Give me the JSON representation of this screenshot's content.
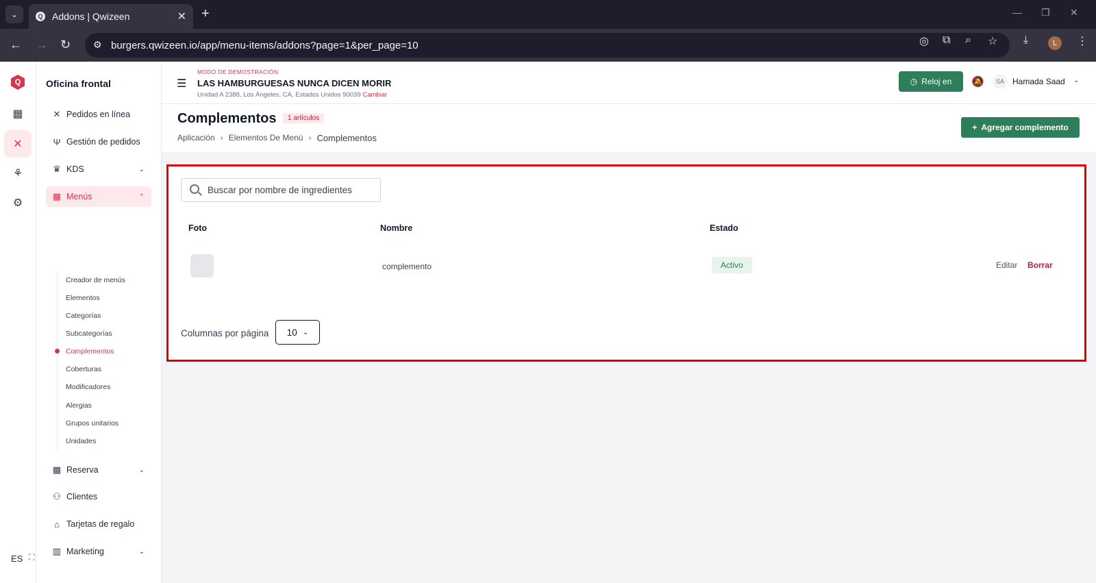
{
  "browser": {
    "tab_title": "Addons | Qwizeen",
    "url_display": "burgers.qwizeen.io/app/menu-items/addons?page=1&per_page=10",
    "profile_initial": "L"
  },
  "rail": {
    "language": "ES"
  },
  "sidebar": {
    "title": "Oficina frontal",
    "items": [
      {
        "label": "Pedidos en línea",
        "icon": "utensils-cross-icon"
      },
      {
        "label": "Gestión de pedidos",
        "icon": "fork-knife-icon"
      },
      {
        "label": "KDS",
        "icon": "chef-hat-icon"
      },
      {
        "label": "Menús",
        "icon": "grid-icon"
      },
      {
        "label": "Reserva",
        "icon": "table-icon"
      },
      {
        "label": "Clientes",
        "icon": "users-icon"
      },
      {
        "label": "Tarjetas de regalo",
        "icon": "gift-icon"
      },
      {
        "label": "Marketing",
        "icon": "bar-chart-icon"
      }
    ],
    "submenu": [
      "Creador de menús",
      "Elementos",
      "Categorías",
      "Subcategorías",
      "Complementos",
      "Coberturas",
      "Modificadores",
      "Alergias",
      "Grupos unitarios",
      "Unidades"
    ]
  },
  "header": {
    "demo_mode": "MODO DE DEMOSTRACIÓN",
    "store_name": "LAS HAMBURGUESAS NUNCA DICEN MORIR",
    "store_address": "Unidad A 2388, Los Ángeles, CA, Estados Unidos 90039",
    "change_link": "Cambiar",
    "clock_button": "Reloj en",
    "user_initials": "SA",
    "user_name": "Hamada Saad"
  },
  "page": {
    "title": "Complementos",
    "count_badge": "1 artículos",
    "breadcrumb": [
      "Aplicación",
      "Elementos De Menú",
      "Complementos"
    ],
    "add_button": "Agregar complemento"
  },
  "table": {
    "search_placeholder": "Buscar por nombre de ingredientes",
    "columns": [
      "Foto",
      "Nombre",
      "Estado"
    ],
    "rows": [
      {
        "name": "complemento",
        "status": "Activo",
        "actions": [
          "Editar",
          "Borrar"
        ]
      }
    ],
    "per_page_label": "Columnas por página",
    "per_page_value": "10"
  },
  "colors": {
    "brand": "#d6354f",
    "primary_button": "#2e7d5b",
    "highlight_border": "#e00000"
  }
}
